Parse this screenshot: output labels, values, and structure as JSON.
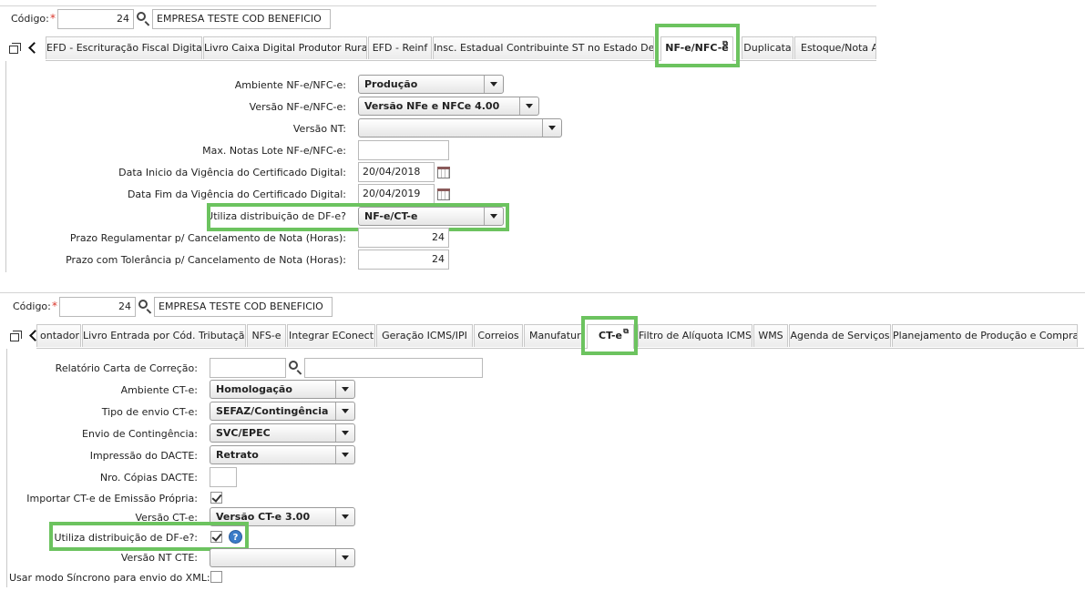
{
  "top": {
    "codigo_label": "Código:",
    "required_mark": "*",
    "code_value": "24",
    "company_name": "EMPRESA TESTE COD BENEFICIO",
    "tabs": [
      "EFD - Escrituração Fiscal Digital",
      "Livro Caixa Digital Produtor Rural",
      "EFD - Reinf",
      "Insc. Estadual Contribuinte ST no Estado Dest.",
      "NF-e/NFC-e",
      "Duplicata",
      "Estoque/Nota Ac"
    ],
    "fields": {
      "ambiente_label": "Ambiente NF-e/NFC-e:",
      "ambiente_value": "Produção",
      "versao_label": "Versão NF-e/NFC-e:",
      "versao_value": "Versão NFe e NFCe 4.00",
      "versao_nt_label": "Versão NT:",
      "versao_nt_value": "",
      "max_notas_label": "Max. Notas Lote NF-e/NFC-e:",
      "max_notas_value": "",
      "data_inicio_label": "Data Inicio da Vigência do Certificado Digital:",
      "data_inicio_value": "20/04/2018",
      "data_fim_label": "Data Fim da Vigência do Certificado Digital:",
      "data_fim_value": "20/04/2019",
      "distribuicao_label": "Utiliza distribuição de DF-e?",
      "distribuicao_value": "NF-e/CT-e",
      "prazo_reg_label": "Prazo Regulamentar p/ Cancelamento de Nota (Horas):",
      "prazo_reg_value": "24",
      "prazo_tol_label": "Prazo com Tolerância p/ Cancelamento de Nota (Horas):",
      "prazo_tol_value": "24"
    }
  },
  "bottom": {
    "codigo_label": "Código:",
    "required_mark": "*",
    "code_value": "24",
    "company_name": "EMPRESA TESTE COD BENEFICIO",
    "tabs": [
      "ontador",
      "Livro Entrada por Cód. Tributação",
      "NFS-e",
      "Integrar EConect",
      "Geração ICMS/IPI",
      "Correios",
      "Manufatura",
      "CT-e",
      "Filtro de Alíquota ICMS",
      "WMS",
      "Agenda de Serviços",
      "Planejamento de Produção e Compras"
    ],
    "fields": {
      "relatorio_label": "Relatório Carta de Correção:",
      "relatorio_code": "",
      "relatorio_desc": "",
      "ambiente_label": "Ambiente CT-e:",
      "ambiente_value": "Homologação",
      "tipo_envio_label": "Tipo de envio CT-e:",
      "tipo_envio_value": "SEFAZ/Contingência",
      "envio_cont_label": "Envio de Contingência:",
      "envio_cont_value": "SVC/EPEC",
      "impressao_label": "Impressão do DACTE:",
      "impressao_value": "Retrato",
      "copias_label": "Nro. Cópias DACTE:",
      "copias_value": "",
      "importar_label": "Importar CT-e de Emissão Própria:",
      "importar_checked": true,
      "versao_label": "Versão CT-e:",
      "versao_value": "Versão CT-e 3.00",
      "distribuicao_label": "Utiliza distribuição de DF-e?:",
      "distribuicao_checked": true,
      "help_glyph": "?",
      "versao_nt_label": "Versão NT CTE:",
      "versao_nt_value": "",
      "modo_sincrono_label": "Usar modo Síncrono para envio do XML:",
      "modo_sincrono_checked": false
    }
  }
}
